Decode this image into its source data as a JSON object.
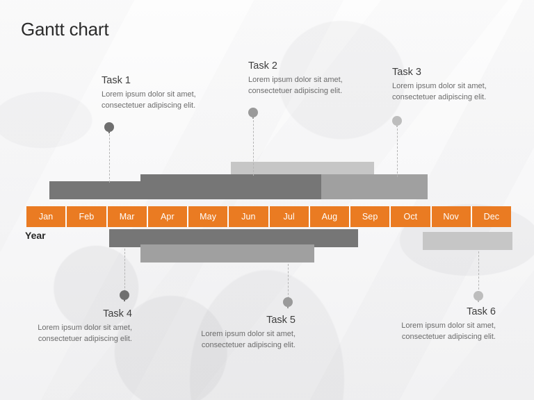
{
  "slide": {
    "title": "Gantt chart",
    "year_label": "Year"
  },
  "timeline": {
    "months": [
      "Jan",
      "Feb",
      "Mar",
      "Apr",
      "May",
      "Jun",
      "Jul",
      "Aug",
      "Sep",
      "Oct",
      "Nov",
      "Dec"
    ],
    "accent_color": "#ea7b22",
    "month_text_color": "#ffffff"
  },
  "tasks": [
    {
      "id": "task-1",
      "title": "Task 1",
      "desc_line1": "Lorem ipsum dolor sit amet,",
      "desc_line2": "consectetuer adipiscing elit.",
      "side": "above",
      "bar_color": "#767676",
      "marker_color": "#6f6f6f"
    },
    {
      "id": "task-2",
      "title": "Task 2",
      "desc_line1": "Lorem ipsum dolor sit amet,",
      "desc_line2": "consectetuer adipiscing elit.",
      "side": "above",
      "bar_color": "#767676",
      "marker_color": "#9a9a9a"
    },
    {
      "id": "task-3",
      "title": "Task 3",
      "desc_line1": "Lorem ipsum dolor sit amet,",
      "desc_line2": "consectetuer adipiscing elit.",
      "side": "above",
      "bar_color": "#a0a0a0",
      "marker_color": "#bdbdbd"
    },
    {
      "id": "task-4",
      "title": "Task 4",
      "desc_line1": "Lorem ipsum dolor sit amet,",
      "desc_line2": "consectetuer adipiscing elit.",
      "side": "below",
      "bar_color": "#767676",
      "marker_color": "#6f6f6f"
    },
    {
      "id": "task-5",
      "title": "Task 5",
      "desc_line1": "Lorem ipsum dolor sit amet,",
      "desc_line2": "consectetuer adipiscing elit.",
      "side": "below",
      "bar_color": "#a0a0a0",
      "marker_color": "#9a9a9a"
    },
    {
      "id": "task-6",
      "title": "Task 6",
      "desc_line1": "Lorem ipsum dolor sit amet,",
      "desc_line2": "consectetuer adipiscing elit.",
      "side": "below",
      "bar_color": "#c6c6c6",
      "marker_color": "#bdbdbd"
    }
  ],
  "chart_data": {
    "type": "bar",
    "title": "Gantt chart",
    "xlabel": "Year",
    "ylabel": "",
    "categories": [
      "Jan",
      "Feb",
      "Mar",
      "Apr",
      "May",
      "Jun",
      "Jul",
      "Aug",
      "Sep",
      "Oct",
      "Nov",
      "Dec"
    ],
    "axis_range_months": [
      1,
      12
    ],
    "series": [
      {
        "name": "Task 1",
        "start_month": 1.6,
        "end_month": 7.8,
        "row": "above-3",
        "color": "#767676"
      },
      {
        "name": "Task 2",
        "start_month": 3.9,
        "end_month": 10.9,
        "row": "above-2",
        "color": "#767676"
      },
      {
        "name": "Task 3",
        "start_month": 6.1,
        "end_month": 9.6,
        "row": "above-1",
        "color": "#c6c6c6"
      },
      {
        "name": "Task 2b",
        "start_month": 7.8,
        "end_month": 10.9,
        "row": "above-3",
        "color": "#a0a0a0"
      },
      {
        "name": "Task 4",
        "start_month": 3.0,
        "end_month": 9.2,
        "row": "below-1",
        "color": "#767676"
      },
      {
        "name": "Task 5",
        "start_month": 3.9,
        "end_month": 8.2,
        "row": "below-2",
        "color": "#a0a0a0"
      },
      {
        "name": "Task 6",
        "start_month": 10.8,
        "end_month": 13.0,
        "row": "below-2",
        "color": "#c6c6c6"
      }
    ],
    "milestones": [
      {
        "name": "Task 1",
        "month": 3.1,
        "color": "#6f6f6f"
      },
      {
        "name": "Task 2",
        "month": 6.6,
        "color": "#9a9a9a"
      },
      {
        "name": "Task 3",
        "month": 10.2,
        "color": "#bdbdbd"
      },
      {
        "name": "Task 4",
        "month": 3.5,
        "color": "#6f6f6f"
      },
      {
        "name": "Task 5",
        "month": 7.5,
        "color": "#9a9a9a"
      },
      {
        "name": "Task 6",
        "month": 12.2,
        "color": "#bdbdbd"
      }
    ],
    "grid": false,
    "legend": "none"
  }
}
